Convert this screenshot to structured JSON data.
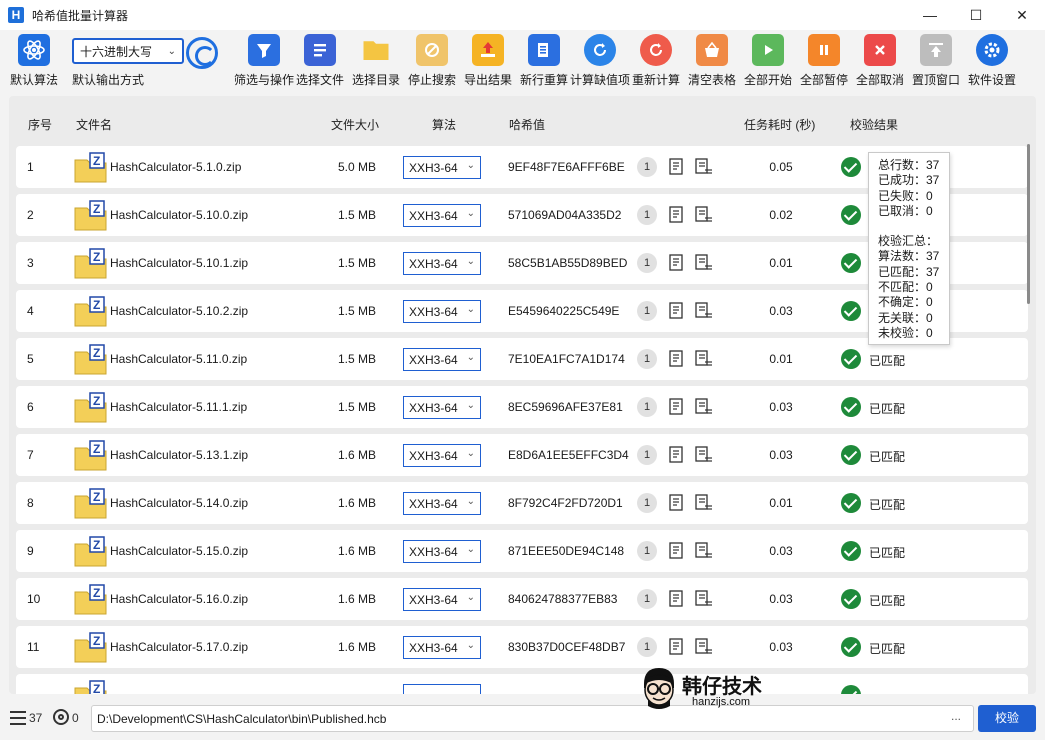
{
  "window": {
    "logo_letter": "H",
    "title": "哈希值批量计算器",
    "min_glyph": "—",
    "max_glyph": "☐",
    "close_glyph": "✕"
  },
  "toolbar": {
    "default_algo_label": "默认算法",
    "output_format_value": "十六进制大写",
    "output_format_label": "默认输出方式",
    "tools": [
      {
        "label": "筛选与操作",
        "icon": "funnel-icon",
        "color": "#2b6fe0"
      },
      {
        "label": "选择文件",
        "icon": "list-icon",
        "color": "#3b63d6"
      },
      {
        "label": "选择目录",
        "icon": "folder-icon",
        "color": "#f4c542"
      },
      {
        "label": "停止搜索",
        "icon": "stop-search-icon",
        "color": "#f0c46a"
      },
      {
        "label": "导出结果",
        "icon": "export-icon",
        "color": "#f5b324"
      },
      {
        "label": "新行重算",
        "icon": "new-row-icon",
        "color": "#2b6fe0"
      },
      {
        "label": "计算缺值项",
        "icon": "recalc-missing-icon",
        "color": "#2b84e8"
      },
      {
        "label": "重新计算",
        "icon": "recalc-icon",
        "color": "#ef5b4b"
      },
      {
        "label": "清空表格",
        "icon": "clear-basket-icon",
        "color": "#f08a46"
      },
      {
        "label": "全部开始",
        "icon": "play-icon",
        "color": "#5cb85c"
      },
      {
        "label": "全部暂停",
        "icon": "pause-icon",
        "color": "#f4862a"
      },
      {
        "label": "全部取消",
        "icon": "cancel-icon",
        "color": "#ec4a4a"
      },
      {
        "label": "置顶窗口",
        "icon": "pin-top-icon",
        "color": "#bdbdbd"
      },
      {
        "label": "软件设置",
        "icon": "gear-icon",
        "color": "#1f6fe0"
      }
    ]
  },
  "table": {
    "headers": {
      "no": "序号",
      "filename": "文件名",
      "size": "文件大小",
      "algo": "算法",
      "hash": "哈希值",
      "time": "任务耗时 (秒)",
      "result": "校验结果"
    },
    "rows": [
      {
        "no": "1",
        "name": "HashCalculator-5.1.0.zip",
        "size": "5.0 MB",
        "algo": "XXH3-64",
        "hash": "9EF48F7E6AFFF6BE",
        "count": "1",
        "time": "0.05",
        "status": ""
      },
      {
        "no": "2",
        "name": "HashCalculator-5.10.0.zip",
        "size": "1.5 MB",
        "algo": "XXH3-64",
        "hash": "571069AD04A335D2",
        "count": "1",
        "time": "0.02",
        "status": ""
      },
      {
        "no": "3",
        "name": "HashCalculator-5.10.1.zip",
        "size": "1.5 MB",
        "algo": "XXH3-64",
        "hash": "58C5B1AB55D89BED",
        "count": "1",
        "time": "0.01",
        "status": ""
      },
      {
        "no": "4",
        "name": "HashCalculator-5.10.2.zip",
        "size": "1.5 MB",
        "algo": "XXH3-64",
        "hash": "E5459640225C549E",
        "count": "1",
        "time": "0.03",
        "status": ""
      },
      {
        "no": "5",
        "name": "HashCalculator-5.11.0.zip",
        "size": "1.5 MB",
        "algo": "XXH3-64",
        "hash": "7E10EA1FC7A1D174",
        "count": "1",
        "time": "0.01",
        "status": "已匹配"
      },
      {
        "no": "6",
        "name": "HashCalculator-5.11.1.zip",
        "size": "1.5 MB",
        "algo": "XXH3-64",
        "hash": "8EC59696AFE37E81",
        "count": "1",
        "time": "0.03",
        "status": "已匹配"
      },
      {
        "no": "7",
        "name": "HashCalculator-5.13.1.zip",
        "size": "1.6 MB",
        "algo": "XXH3-64",
        "hash": "E8D6A1EE5EFFC3D4",
        "count": "1",
        "time": "0.03",
        "status": "已匹配"
      },
      {
        "no": "8",
        "name": "HashCalculator-5.14.0.zip",
        "size": "1.6 MB",
        "algo": "XXH3-64",
        "hash": "8F792C4F2FD720D1",
        "count": "1",
        "time": "0.01",
        "status": "已匹配"
      },
      {
        "no": "9",
        "name": "HashCalculator-5.15.0.zip",
        "size": "1.6 MB",
        "algo": "XXH3-64",
        "hash": "871EEE50DE94C148",
        "count": "1",
        "time": "0.03",
        "status": "已匹配"
      },
      {
        "no": "10",
        "name": "HashCalculator-5.16.0.zip",
        "size": "1.6 MB",
        "algo": "XXH3-64",
        "hash": "840624788377EB83",
        "count": "1",
        "time": "0.03",
        "status": "已匹配"
      },
      {
        "no": "11",
        "name": "HashCalculator-5.17.0.zip",
        "size": "1.6 MB",
        "algo": "XXH3-64",
        "hash": "830B37D0CEF48DB7",
        "count": "1",
        "time": "0.03",
        "status": "已匹配"
      }
    ]
  },
  "tooltip": {
    "lines_a": [
      "总行数：37",
      "已成功：37",
      "已失败：0",
      "已取消：0"
    ],
    "lines_b": [
      "校验汇总：",
      "算法数：37",
      "已匹配：37",
      "不匹配：0",
      "不确定：0",
      "无关联：0",
      "未校验：0"
    ]
  },
  "watermark": {
    "title": "韩仔技术",
    "site": "hanzijs.com"
  },
  "bottom": {
    "row_count": "37",
    "ring_count": "0",
    "path": "D:\\Development\\CS\\HashCalculator\\bin\\Published.hcb",
    "path_dots": "...",
    "button_label": "校验"
  },
  "colors": {
    "accent": "#1f5fd1",
    "match_green": "#1e8a3a"
  }
}
